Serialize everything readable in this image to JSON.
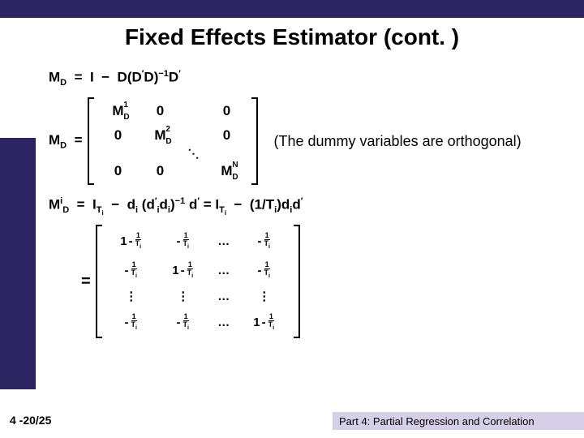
{
  "title": "Fixed Effects Estimator (cont. )",
  "eq1": {
    "lhs": "M",
    "lhs_sub": "D",
    "eq": "=",
    "I": "I",
    "minus": "−",
    "D": "D",
    "lp": "(",
    "Dp1": "D",
    "prime1": "′",
    "Dp2": "D",
    "rp": ")",
    "neg1": "−1",
    "Dp3": "D",
    "prime2": "′"
  },
  "row2": {
    "lhs": "M",
    "lhs_sub": "D",
    "eq": "=",
    "zero": "0",
    "m": "M",
    "msub": "D",
    "sup1": "1",
    "sup2": "2",
    "supN": "N",
    "note": "(The dummy variables are orthogonal)",
    "ddots": "⋱",
    "vdots": "⋮"
  },
  "eq3": {
    "M": "M",
    "i": "i",
    "D": "D",
    "eq": "=",
    "I": "I",
    "Tsub": "T",
    "isub": "i",
    "minus": "−",
    "d": "d",
    "lp": "(",
    "prime": "′",
    "rp": ")",
    "neg1": "−1",
    "eq2": " = ",
    "oneover": "(1/T",
    "close": ")"
  },
  "row4": {
    "eq": "=",
    "one": "1",
    "minus": "-",
    "num": "1",
    "den_T": "T",
    "den_i": "i",
    "hdots": "…",
    "vdots": "⋮"
  },
  "footer": {
    "left": "4 -20/25",
    "right": "Part 4: Partial Regression and Correlation"
  }
}
